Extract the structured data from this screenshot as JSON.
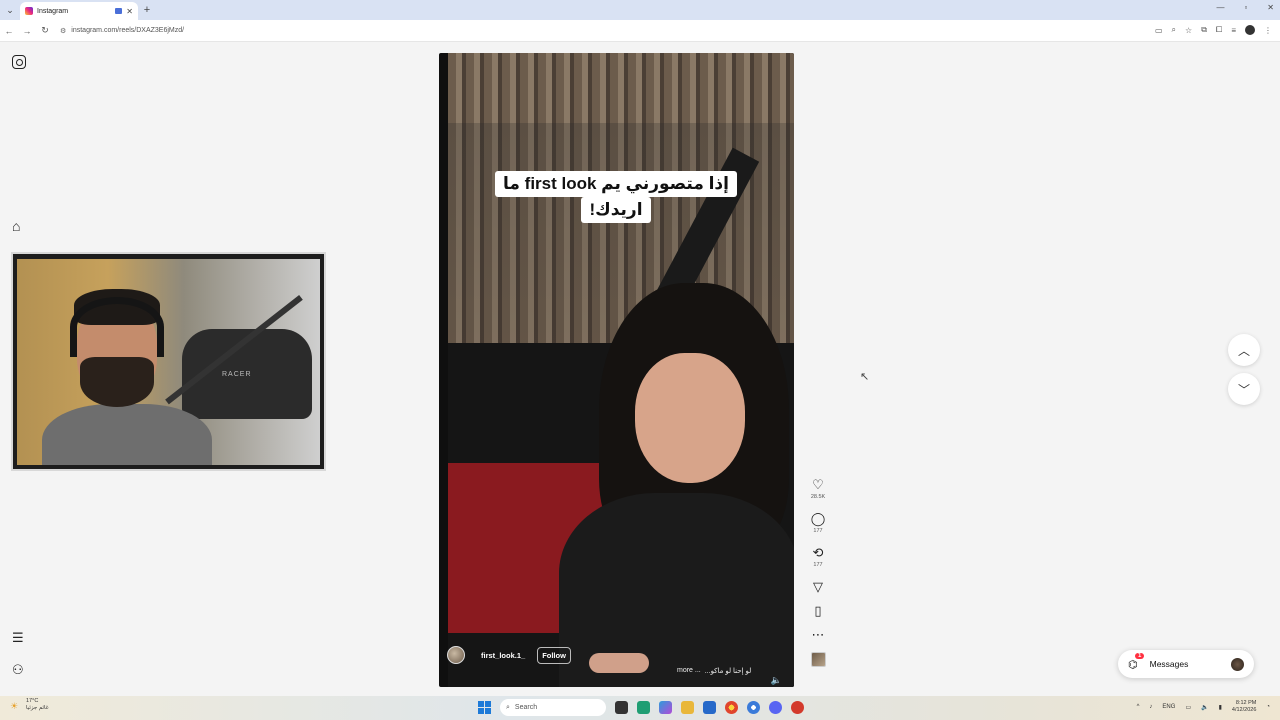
{
  "browser": {
    "tab_title": "Instagram",
    "url": "instagram.com/reels/DXAZ3E6jMzd/",
    "new_tab_symbol": "+",
    "tab_close_symbol": "✕"
  },
  "reel": {
    "caption_line1": "إذا متصورني يم first look ما",
    "caption_line2": "اريدك!",
    "username": "first_look.1_",
    "follow_label": "Follow",
    "description": "لو إحنا لو ماكو...",
    "more_label": "more"
  },
  "actions": {
    "likes": "28.5K",
    "comments": "177",
    "reposts": "177"
  },
  "webcam": {
    "chair_text": "RACER"
  },
  "messages": {
    "label": "Messages",
    "badge": "1"
  },
  "taskbar": {
    "weather_temp": "17°C",
    "weather_desc": "غائم جزئيا",
    "search_placeholder": "Search",
    "lang": "ENG",
    "time": "8:12 PM",
    "date": "4/12/2026"
  },
  "colors": {
    "accent_badge": "#ff3040",
    "page_bg": "#f4f4f4",
    "tab_bar": "#d9e2f3"
  },
  "icons": {
    "instagram": "instagram-icon",
    "home": "home-icon",
    "menu": "hamburger-menu-icon",
    "apps": "apps-icon",
    "like": "heart-icon",
    "comment": "comment-icon",
    "repost": "repost-icon",
    "share": "send-icon",
    "save": "bookmark-icon",
    "more": "more-icon"
  }
}
